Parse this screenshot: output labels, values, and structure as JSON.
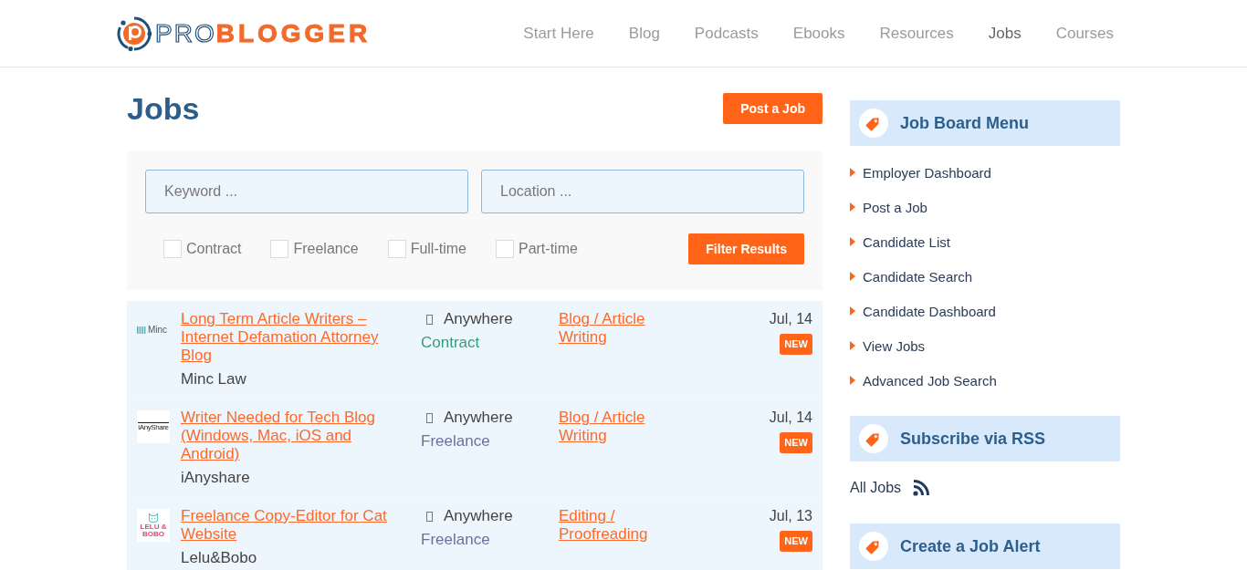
{
  "header": {
    "logo": {
      "wordmark": "PRO**BLOGGER**"
    },
    "nav": [
      {
        "label": "Start Here",
        "selected": false
      },
      {
        "label": "Blog",
        "selected": false
      },
      {
        "label": "Podcasts",
        "selected": false
      },
      {
        "label": "Ebooks",
        "selected": false
      },
      {
        "label": "Resources",
        "selected": false
      },
      {
        "label": "Jobs",
        "selected": true
      },
      {
        "label": "Courses",
        "selected": false
      }
    ]
  },
  "page": {
    "title": "Jobs",
    "post_button": "Post a Job"
  },
  "filters": {
    "keyword": {
      "placeholder": "Keyword ..."
    },
    "location": {
      "placeholder": "Location ..."
    },
    "job_types": [
      {
        "label": "Contract",
        "checked": false
      },
      {
        "label": "Freelance",
        "checked": false
      },
      {
        "label": "Full-time",
        "checked": false
      },
      {
        "label": "Part-time",
        "checked": false
      }
    ],
    "submit": "Filter Results"
  },
  "listings": [
    {
      "logo": {
        "kind": "wordmark",
        "text": "Minc"
      },
      "title": "Long Term Article Writers – Internet Defamation Attorney Blog",
      "company": "Minc Law",
      "location": "Anywhere",
      "job_type": {
        "label": "Contract",
        "color": "#3a9b78"
      },
      "category": "Blog / Article Writing",
      "date": "Jul, 14",
      "badge": "NEW"
    },
    {
      "logo": {
        "kind": "tile",
        "text": "iAnyShare"
      },
      "title": "Writer Needed for Tech Blog (Windows, Mac, iOS and Android)",
      "company": "iAnyshare",
      "location": "Anywhere",
      "job_type": {
        "label": "Freelance",
        "color": "#6d6f9c"
      },
      "category": "Blog / Article Writing",
      "date": "Jul, 14",
      "badge": "NEW"
    },
    {
      "logo": {
        "kind": "cat-tile",
        "text": "LELU & BOBO"
      },
      "title": "Freelance Copy-Editor for Cat Website",
      "company": "Lelu&Bobo",
      "location": "Anywhere",
      "job_type": {
        "label": "Freelance",
        "color": "#6d6f9c"
      },
      "category": "Editing / Proofreading",
      "date": "Jul, 13",
      "badge": "NEW"
    }
  ],
  "sidebar": {
    "widgets": [
      {
        "kind": "menu",
        "title": "Job Board Menu",
        "items": [
          "Employer Dashboard",
          "Post a Job",
          "Candidate List",
          "Candidate Search",
          "Candidate Dashboard",
          "View Jobs",
          "Advanced Job Search"
        ]
      },
      {
        "kind": "feeds",
        "title": "Subscribe via RSS",
        "items": [
          "All Jobs"
        ]
      },
      {
        "kind": "header",
        "title": "Create a Job Alert"
      }
    ]
  }
}
